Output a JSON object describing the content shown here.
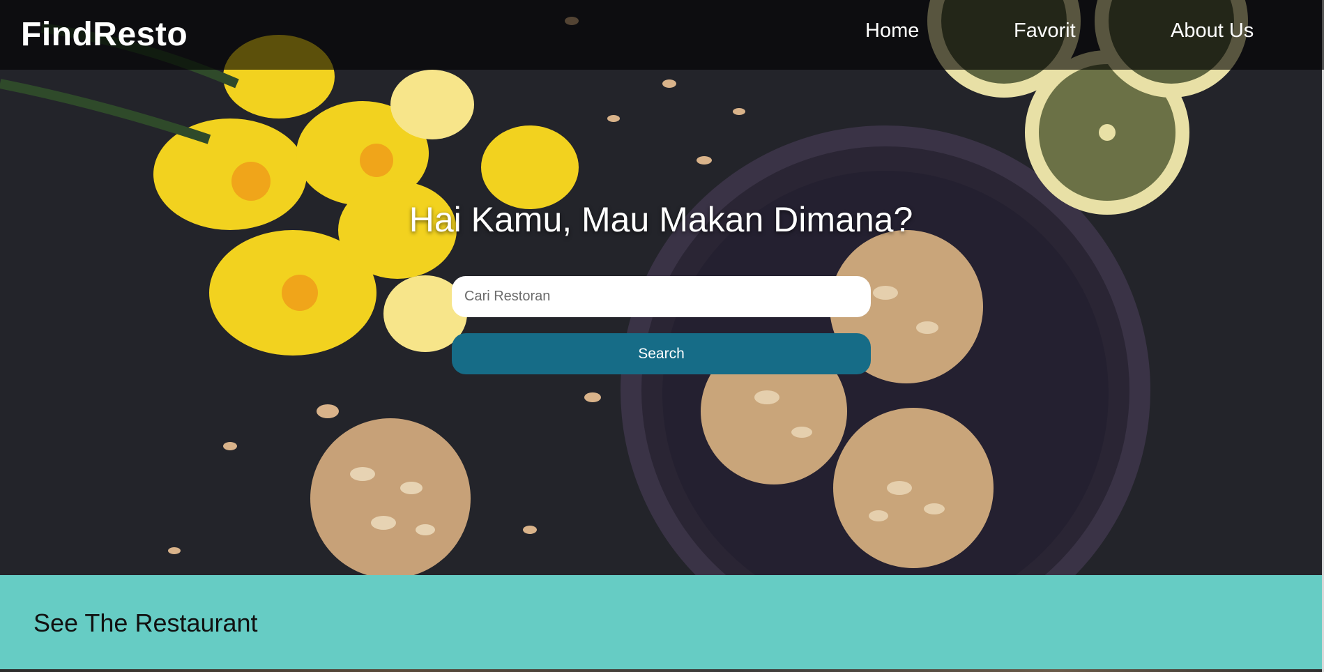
{
  "app": {
    "brand": "FindResto"
  },
  "nav": {
    "items": [
      {
        "label": "Home"
      },
      {
        "label": "Favorit"
      },
      {
        "label": "About Us"
      }
    ]
  },
  "hero": {
    "title": "Hai Kamu, Mau Makan Dimana?",
    "search": {
      "placeholder": "Cari Restoran",
      "value": "",
      "button_label": "Search"
    }
  },
  "section": {
    "title": "See The Restaurant"
  },
  "colors": {
    "navbar_bg": "#000000",
    "search_button": "#166c87",
    "section_band": "#66ccc4",
    "text_light": "#ffffff",
    "text_dark": "#111111"
  }
}
